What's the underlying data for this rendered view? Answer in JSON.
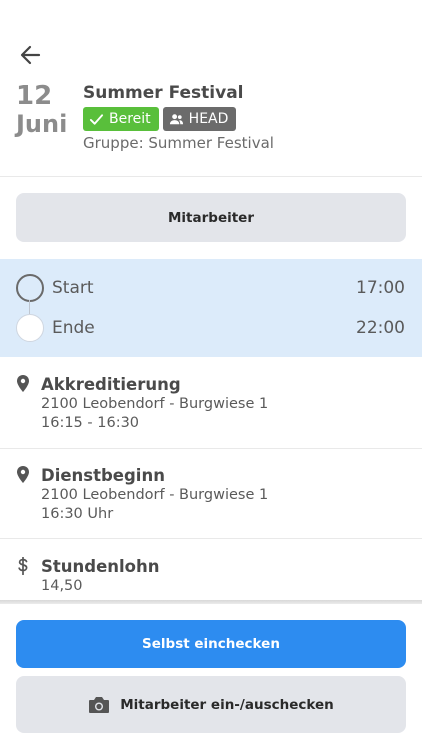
{
  "header": {
    "day": "12",
    "month": "Juni",
    "title": "Summer Festival",
    "badges": {
      "ready": "Bereit",
      "head": "HEAD"
    },
    "group": "Gruppe: Summer Festival"
  },
  "staff_button": "Mitarbeiter",
  "times": {
    "start_label": "Start",
    "start_value": "17:00",
    "end_label": "Ende",
    "end_value": "22:00"
  },
  "info": {
    "accreditation": {
      "title": "Akkreditierung",
      "address": "2100 Leobendorf - Burgwiese 1",
      "time": "16:15 - 16:30"
    },
    "service_start": {
      "title": "Dienstbeginn",
      "address": "2100 Leobendorf - Burgwiese 1",
      "time": "16:30 Uhr"
    },
    "hourly_wage": {
      "title": "Stundenlohn",
      "value": "14,50"
    }
  },
  "actions": {
    "self_checkin": "Selbst einchecken",
    "staff_checkin": "Mitarbeiter ein-/auschecken"
  },
  "colors": {
    "blue": "#2d8cf0",
    "green": "#59bf3b",
    "time_bg": "#dcebfa"
  },
  "icons": [
    "back-arrow-icon",
    "check-icon",
    "people-icon",
    "location-pin-icon",
    "dollar-icon",
    "camera-icon"
  ]
}
